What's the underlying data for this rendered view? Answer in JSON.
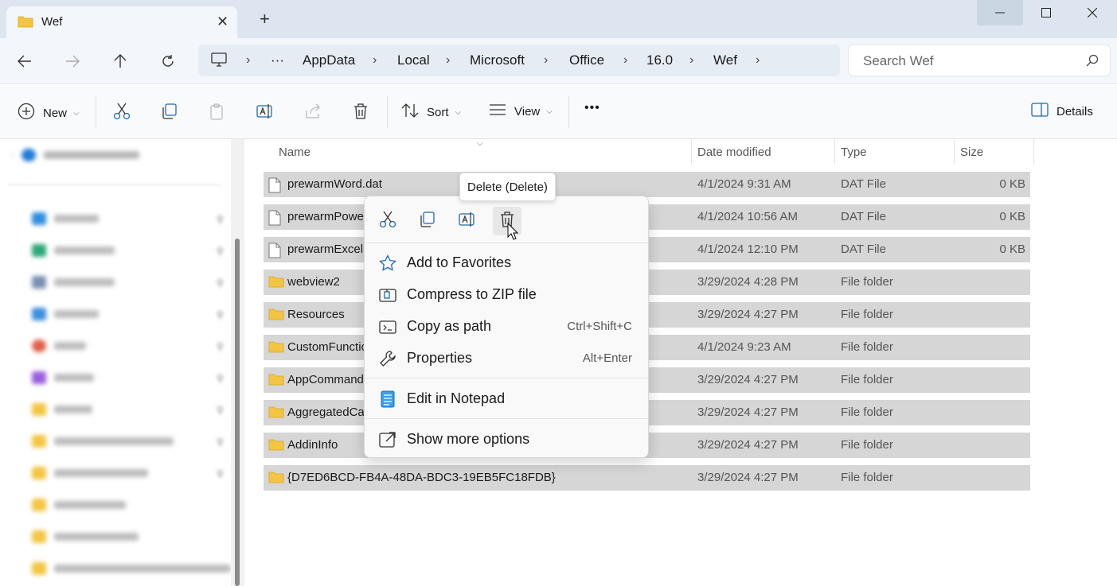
{
  "window": {
    "tab_title": "Wef",
    "close_tab_glyph": "✕",
    "new_tab_glyph": "+",
    "controls": [
      "minimize",
      "maximize",
      "close"
    ]
  },
  "nav": {
    "breadcrumbs": [
      "AppData",
      "Local",
      "Microsoft",
      "Office",
      "16.0",
      "Wef"
    ],
    "ellipsis": "···",
    "separator": "›",
    "search_placeholder": "Search Wef"
  },
  "toolbar": {
    "new_label": "New",
    "sort_label": "Sort",
    "view_label": "View",
    "more_label": "•••",
    "details_label": "Details"
  },
  "columns": {
    "name": "Name",
    "date": "Date modified",
    "type": "Type",
    "size": "Size"
  },
  "files": [
    {
      "name": "prewarmWord.dat",
      "date": "4/1/2024 9:31 AM",
      "type": "DAT File",
      "size": "0 KB",
      "icon": "file-icon"
    },
    {
      "name": "prewarmPowerPoint.dat",
      "date": "4/1/2024 10:56 AM",
      "type": "DAT File",
      "size": "0 KB",
      "icon": "file-icon"
    },
    {
      "name": "prewarmExcel.dat",
      "date": "4/1/2024 12:10 PM",
      "type": "DAT File",
      "size": "0 KB",
      "icon": "file-icon"
    },
    {
      "name": "webview2",
      "date": "3/29/2024 4:28 PM",
      "type": "File folder",
      "size": "",
      "icon": "folder-icon"
    },
    {
      "name": "Resources",
      "date": "3/29/2024 4:27 PM",
      "type": "File folder",
      "size": "",
      "icon": "folder-icon"
    },
    {
      "name": "CustomFunctions",
      "date": "4/1/2024 9:23 AM",
      "type": "File folder",
      "size": "",
      "icon": "folder-icon"
    },
    {
      "name": "AppCommands",
      "date": "3/29/2024 4:27 PM",
      "type": "File folder",
      "size": "",
      "icon": "folder-icon"
    },
    {
      "name": "AggregatedCache",
      "date": "3/29/2024 4:27 PM",
      "type": "File folder",
      "size": "",
      "icon": "folder-icon"
    },
    {
      "name": "AddinInfo",
      "date": "3/29/2024 4:27 PM",
      "type": "File folder",
      "size": "",
      "icon": "folder-icon"
    },
    {
      "name": "{D7ED6BCD-FB4A-48DA-BDC3-19EB5FC18FDB}",
      "date": "3/29/2024 4:27 PM",
      "type": "File folder",
      "size": "",
      "icon": "folder-icon"
    }
  ],
  "tooltip": "Delete (Delete)",
  "context_menu": {
    "quick_actions": [
      "cut-icon",
      "copy-icon",
      "rename-icon",
      "delete-icon"
    ],
    "items": [
      {
        "label": "Add to Favorites",
        "shortcut": "",
        "icon": "star-icon"
      },
      {
        "label": "Compress to ZIP file",
        "shortcut": "",
        "icon": "zip-icon"
      },
      {
        "label": "Copy as path",
        "shortcut": "Ctrl+Shift+C",
        "icon": "path-icon"
      },
      {
        "label": "Properties",
        "shortcut": "Alt+Enter",
        "icon": "wrench-icon"
      },
      {
        "label": "Edit in Notepad",
        "shortcut": "",
        "icon": "notepad-icon"
      },
      {
        "label": "Show more options",
        "shortcut": "",
        "icon": "share-icon"
      }
    ]
  },
  "colors": {
    "selection": "#d6d6d6",
    "accent": "#1f6ab0",
    "folder": "#f4c542",
    "titlebar": "#dde6f0"
  }
}
